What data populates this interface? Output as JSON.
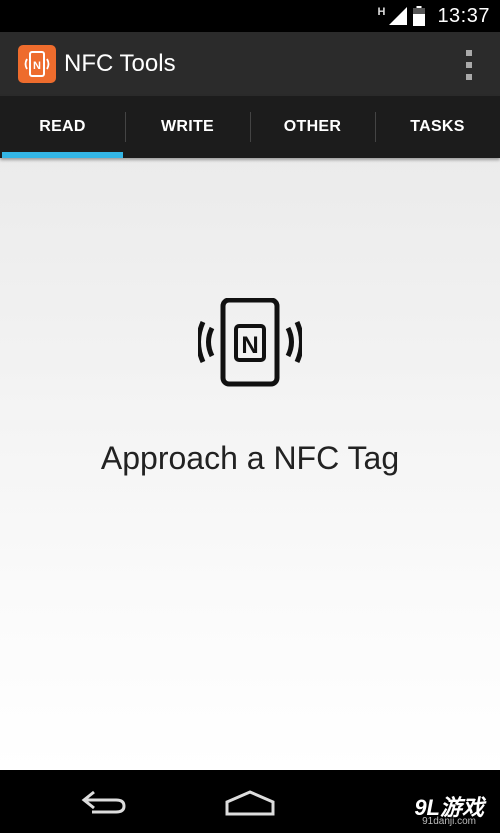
{
  "status_bar": {
    "network_indicator": "H",
    "time": "13:37",
    "icons": [
      "signal-icon",
      "battery-icon"
    ]
  },
  "action_bar": {
    "title": "NFC Tools",
    "app_icon_letter": "N",
    "overflow_icon": "overflow-menu-icon"
  },
  "tabs": [
    {
      "label": "READ",
      "active": true
    },
    {
      "label": "WRITE",
      "active": false
    },
    {
      "label": "OTHER",
      "active": false
    },
    {
      "label": "TASKS",
      "active": false
    }
  ],
  "main": {
    "graphic_icon": "nfc-phone-icon",
    "graphic_letter": "N",
    "message": "Approach a NFC Tag"
  },
  "nav_bar": {
    "icons": [
      "back-icon",
      "home-icon"
    ]
  },
  "watermark": {
    "logo": "9L游戏",
    "url": "91danji.com"
  },
  "colors": {
    "accent": "#33b5e5",
    "brand": "#ee6c2d",
    "action_bar": "#2b2b2b",
    "tab_bar": "#1c1c1c"
  }
}
